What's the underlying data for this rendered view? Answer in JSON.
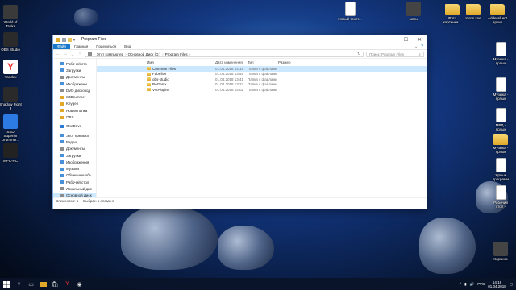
{
  "desktop": {
    "icons_left": [
      {
        "label": "World of\nTanks",
        "icon": "tank-game-icon",
        "color": "#3a3a3a"
      },
      {
        "label": "OBS Studio",
        "icon": "obs-icon",
        "color": "#2b2b2b"
      },
      {
        "label": "Yandex",
        "icon": "yandex-icon",
        "color": "#ffffff"
      },
      {
        "label": "Shadow Fight\n3",
        "icon": "game-icon",
        "color": "#2a2a2a"
      },
      {
        "label": "SSD\nSuperior\nDrummer...",
        "icon": "drummer-icon",
        "color": "#2c7be5"
      },
      {
        "label": "MPC-HC",
        "icon": "mpc-icon",
        "color": "#222222"
      }
    ],
    "icons_top": [
      {
        "label": "Новый текст...",
        "type": "doc"
      },
      {
        "label": "зимы",
        "type": "app"
      },
      {
        "label": "Фото\nкартинки...",
        "type": "folder"
      },
      {
        "label": "Icons sne",
        "type": "folder"
      },
      {
        "label": "Adderall.ent\nархив",
        "type": "folder"
      }
    ],
    "icons_right": [
      {
        "label": "Музыка -\nярлык",
        "type": "doc"
      },
      {
        "label": "Музыка -\nярлык",
        "type": "doc"
      },
      {
        "label": "МВД -\nярлык",
        "type": "doc"
      },
      {
        "label": "Музыка -\nярлык",
        "type": "folder"
      },
      {
        "label": "Ярлык\nпрограмм",
        "type": "doc"
      },
      {
        "label": "Рабочий\nстол -",
        "type": "doc"
      },
      {
        "label": "Корзина",
        "type": "app"
      }
    ]
  },
  "window": {
    "title": "Program Files",
    "ribbon_tabs": [
      "Файл",
      "Главная",
      "Поделиться",
      "Вид"
    ],
    "address": {
      "parts": [
        "Этот компьютер",
        "Основной Диск (D:)",
        "Program Files"
      ]
    },
    "search_placeholder": "Поиск: Program Files",
    "nav_items": [
      {
        "label": "Рабочий сто",
        "sel": false,
        "color": "#4a90d9"
      },
      {
        "label": "Загрузки",
        "sel": false,
        "color": "#4a90d9"
      },
      {
        "label": "Документы",
        "sel": false,
        "color": "#8c8c8c"
      },
      {
        "label": "Изображени",
        "sel": false,
        "color": "#4a90d9"
      },
      {
        "label": "DVD дисковод",
        "sel": false,
        "color": "#8c8c8c"
      },
      {
        "label": "S3Drummer",
        "sel": false,
        "color": "#e0a92a"
      },
      {
        "label": "Keygen",
        "sel": false,
        "color": "#e0a92a"
      },
      {
        "label": "Новая папка",
        "sel": false,
        "color": "#e0a92a"
      },
      {
        "label": "OBS",
        "sel": false,
        "color": "#e0a92a"
      },
      {
        "label": "OneDrive",
        "sel": false,
        "color": "#2b7cd3",
        "gap": true
      },
      {
        "label": "Этот компьют",
        "sel": false,
        "color": "#4a90d9",
        "gap": true
      },
      {
        "label": "Видео",
        "sel": false,
        "color": "#4a90d9"
      },
      {
        "label": "Документы",
        "sel": false,
        "color": "#8c8c8c"
      },
      {
        "label": "Загрузки",
        "sel": false,
        "color": "#4a90d9"
      },
      {
        "label": "Изображения",
        "sel": false,
        "color": "#4a90d9"
      },
      {
        "label": "Музыка",
        "sel": false,
        "color": "#4a90d9"
      },
      {
        "label": "Объемные объ",
        "sel": false,
        "color": "#4a90d9"
      },
      {
        "label": "Рабочий стол",
        "sel": false,
        "color": "#4a90d9"
      },
      {
        "label": "Локальный дис",
        "sel": false,
        "color": "#8c8c8c"
      },
      {
        "label": "Основной Диск",
        "sel": true,
        "color": "#8c8c8c"
      },
      {
        "label": "DVD дисковод (",
        "sel": false,
        "color": "#8c8c8c"
      }
    ],
    "columns": [
      "Имя",
      "Дата изменения",
      "Тип",
      "Размер"
    ],
    "files": [
      {
        "name": "Common Files",
        "date": "01.04.2018 14:18",
        "type": "Папка с файлами",
        "sel": true
      },
      {
        "name": "FabFilter",
        "date": "01.04.2018 13:55",
        "type": "Папка с файлами",
        "sel": false
      },
      {
        "name": "obs-studio",
        "date": "01.04.2018 13:41",
        "type": "Папка с файлами",
        "sel": false
      },
      {
        "name": "ReGenix",
        "date": "01.04.2018 13:22",
        "type": "Папка с файлами",
        "sel": false
      },
      {
        "name": "VstPlugins",
        "date": "01.04.2018 14:02",
        "type": "Папка с файлами",
        "sel": false
      }
    ],
    "status": {
      "count": "Элементов: 5",
      "selected": "Выбран 1 элемент"
    }
  },
  "taskbar": {
    "lang": "РУС",
    "time": "14:18",
    "date": "01.04.2018"
  }
}
